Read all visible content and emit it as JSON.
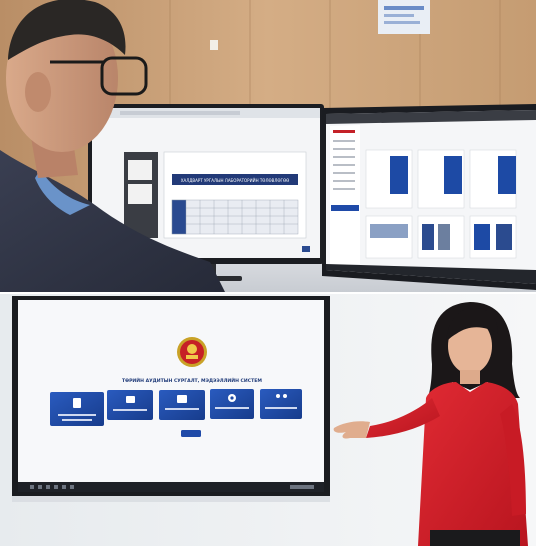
{
  "top_panel": {
    "left_monitor": {
      "table_title": "ХАЛДВАРТ УРГАЛЫН ЛАБОРАТОРИЙН ТӨЛӨВЛӨГӨӨ"
    },
    "right_monitor": {}
  },
  "bottom_panel": {
    "screen": {
      "title": "ТӨРИЙН АУДИТЫН СУРГАЛТ, МЭДЭЭЛЛИЙН СИСТЕМ",
      "cards": [
        {
          "icon": "document-icon"
        },
        {
          "icon": "monitor-icon"
        },
        {
          "icon": "presentation-icon"
        },
        {
          "icon": "gear-icon"
        },
        {
          "icon": "people-icon"
        }
      ],
      "button_label": "",
      "accent_color": "#1f4aa8"
    }
  },
  "colors": {
    "wood_wall": "#c9a27a",
    "card_blue": "#1d4aa5",
    "sweater_red": "#d6202a"
  }
}
